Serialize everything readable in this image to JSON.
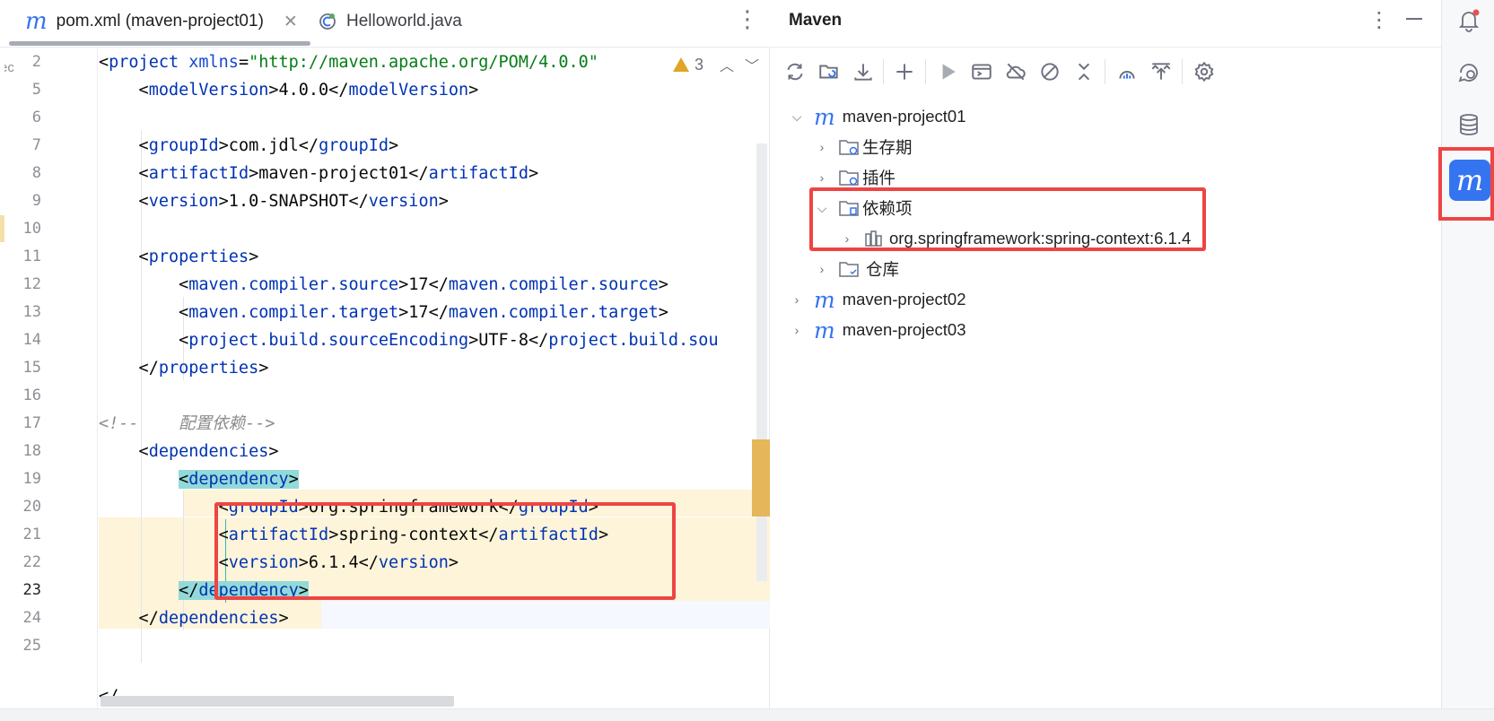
{
  "editor": {
    "tabs": [
      {
        "label": "pom.xml (maven-project01)",
        "icon": "maven-file-icon",
        "active": true
      },
      {
        "label": "Helloworld.java",
        "icon": "java-class-icon",
        "active": false
      }
    ],
    "gutter_left_fragment": "ec",
    "warning_count": "3",
    "lines": [
      {
        "no": "2",
        "tokens": [
          [
            "p",
            "<"
          ],
          [
            "tag",
            "project"
          ],
          [
            "p",
            " "
          ],
          [
            "attr",
            "xmlns"
          ],
          [
            "p",
            "="
          ],
          [
            "str",
            "\"http://maven.apache.org/POM/4.0.0\""
          ]
        ]
      },
      {
        "no": "5",
        "tokens": [
          [
            "p",
            "    <"
          ],
          [
            "tag",
            "modelVersion"
          ],
          [
            "p",
            ">4.0.0</"
          ],
          [
            "tag",
            "modelVersion"
          ],
          [
            "p",
            ">"
          ]
        ]
      },
      {
        "no": "6",
        "tokens": [
          [
            "p",
            ""
          ]
        ]
      },
      {
        "no": "7",
        "tokens": [
          [
            "p",
            "    <"
          ],
          [
            "tag",
            "groupId"
          ],
          [
            "p",
            ">com.jdl</"
          ],
          [
            "tag",
            "groupId"
          ],
          [
            "p",
            ">"
          ]
        ]
      },
      {
        "no": "8",
        "tokens": [
          [
            "p",
            "    <"
          ],
          [
            "tag",
            "artifactId"
          ],
          [
            "p",
            ">maven-project01</"
          ],
          [
            "tag",
            "artifactId"
          ],
          [
            "p",
            ">"
          ]
        ]
      },
      {
        "no": "9",
        "tokens": [
          [
            "p",
            "    <"
          ],
          [
            "tag",
            "version"
          ],
          [
            "p",
            ">1.0-SNAPSHOT</"
          ],
          [
            "tag",
            "version"
          ],
          [
            "p",
            ">"
          ]
        ]
      },
      {
        "no": "10",
        "tokens": [
          [
            "p",
            ""
          ]
        ]
      },
      {
        "no": "11",
        "tokens": [
          [
            "p",
            "    <"
          ],
          [
            "tag",
            "properties"
          ],
          [
            "p",
            ">"
          ]
        ]
      },
      {
        "no": "12",
        "tokens": [
          [
            "p",
            "        <"
          ],
          [
            "tag",
            "maven.compiler.source"
          ],
          [
            "p",
            ">17</"
          ],
          [
            "tag",
            "maven.compiler.source"
          ],
          [
            "p",
            ">"
          ]
        ]
      },
      {
        "no": "13",
        "tokens": [
          [
            "p",
            "        <"
          ],
          [
            "tag",
            "maven.compiler.target"
          ],
          [
            "p",
            ">17</"
          ],
          [
            "tag",
            "maven.compiler.target"
          ],
          [
            "p",
            ">"
          ]
        ]
      },
      {
        "no": "14",
        "tokens": [
          [
            "p",
            "        <"
          ],
          [
            "tag",
            "project.build.sourceEncoding"
          ],
          [
            "p",
            ">UTF-8</"
          ],
          [
            "tag",
            "project.build.sou"
          ]
        ]
      },
      {
        "no": "15",
        "tokens": [
          [
            "p",
            "    </"
          ],
          [
            "tag",
            "properties"
          ],
          [
            "p",
            ">"
          ]
        ]
      },
      {
        "no": "16",
        "tokens": [
          [
            "p",
            ""
          ]
        ]
      },
      {
        "no": "17",
        "tokens": [
          [
            "cmt",
            "<!--    配置依赖-->"
          ]
        ]
      },
      {
        "no": "18",
        "tokens": [
          [
            "p",
            "    <"
          ],
          [
            "tag",
            "dependencies"
          ],
          [
            "p",
            ">"
          ]
        ]
      },
      {
        "no": "19",
        "tokens": [
          [
            "p",
            "        "
          ],
          [
            "m",
            "<"
          ],
          [
            "mtag",
            "dependency"
          ],
          [
            "m",
            ">"
          ]
        ]
      },
      {
        "no": "20",
        "tokens": [
          [
            "p",
            "            <"
          ],
          [
            "tag",
            "groupId"
          ],
          [
            "p",
            ">org.springframework</"
          ],
          [
            "tag",
            "groupId"
          ],
          [
            "p",
            ">"
          ]
        ]
      },
      {
        "no": "21",
        "tokens": [
          [
            "p",
            "            <"
          ],
          [
            "tag",
            "artifactId"
          ],
          [
            "p",
            ">spring-context</"
          ],
          [
            "tag",
            "artifactId"
          ],
          [
            "p",
            ">"
          ]
        ]
      },
      {
        "no": "22",
        "tokens": [
          [
            "p",
            "            <"
          ],
          [
            "tag",
            "version"
          ],
          [
            "p",
            ">6.1.4</"
          ],
          [
            "tag",
            "version"
          ],
          [
            "p",
            ">"
          ]
        ]
      },
      {
        "no": "23",
        "tokens": [
          [
            "p",
            "        "
          ],
          [
            "m",
            "</"
          ],
          [
            "mtag",
            "dependency"
          ],
          [
            "m",
            ">"
          ]
        ]
      },
      {
        "no": "24",
        "tokens": [
          [
            "p",
            "    </"
          ],
          [
            "tag",
            "dependencies"
          ],
          [
            "p",
            ">"
          ]
        ]
      },
      {
        "no": "25",
        "tokens": [
          [
            "p",
            ""
          ]
        ]
      }
    ],
    "current_line": "23",
    "tail_fragment": "</"
  },
  "maven": {
    "title": "Maven",
    "toolbar": [
      "reload-icon",
      "reload-folder-icon",
      "download-icon",
      "add-icon",
      "run-icon",
      "run-config-icon",
      "offline-icon",
      "skip-tests-icon",
      "collapse-icon",
      "analyze-icon",
      "show-dependencies-icon",
      "settings-icon"
    ],
    "tree": [
      {
        "label": "maven-project01",
        "type": "project",
        "expanded": true,
        "level": 0
      },
      {
        "label": "生存期",
        "type": "lifecycle",
        "expanded": false,
        "level": 1
      },
      {
        "label": "插件",
        "type": "plugins",
        "expanded": false,
        "level": 1
      },
      {
        "label": "依赖项",
        "type": "dependencies",
        "expanded": true,
        "level": 1
      },
      {
        "label": "org.springframework:spring-context:6.1.4",
        "type": "library",
        "expanded": false,
        "level": 2
      },
      {
        "label": "仓库",
        "type": "repositories",
        "expanded": false,
        "level": 1
      },
      {
        "label": "maven-project02",
        "type": "project",
        "expanded": false,
        "level": 0
      },
      {
        "label": "maven-project03",
        "type": "project",
        "expanded": false,
        "level": 0
      }
    ]
  },
  "right_strip": [
    "notifications-icon",
    "ai-assistant-icon",
    "database-icon",
    "maven-tool-icon"
  ],
  "colors": {
    "accent": "#3574f0",
    "highlight_box": "#ee4444",
    "tag": "#0033b3",
    "string": "#067d17"
  }
}
